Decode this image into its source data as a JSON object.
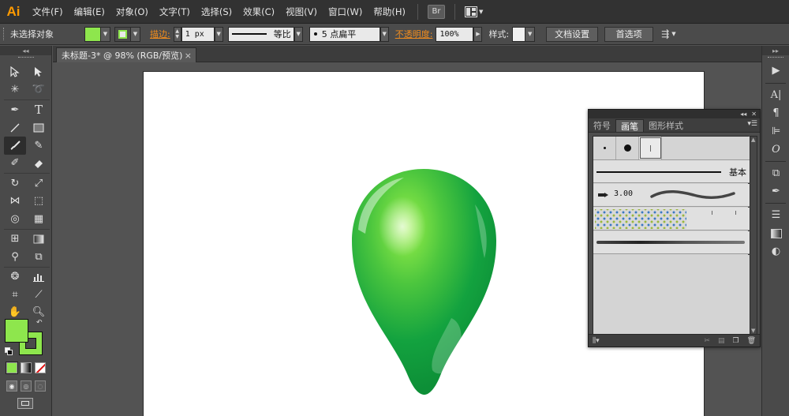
{
  "app": {
    "logo": "Ai"
  },
  "menu": {
    "items": [
      "文件(F)",
      "编辑(E)",
      "对象(O)",
      "文字(T)",
      "选择(S)",
      "效果(C)",
      "视图(V)",
      "窗口(W)",
      "帮助(H)"
    ],
    "bridge_icon": "Br"
  },
  "control_bar": {
    "selection_status": "未选择对象",
    "fill_color": "#8EE64D",
    "stroke_label": "描边:",
    "stroke_weight": "1 px",
    "stroke_profile": "等比",
    "brush_definition": "5 点扁平",
    "opacity_label": "不透明度:",
    "opacity_value": "100%",
    "style_label": "样式:",
    "document_setup_button": "文档设置",
    "preferences_button": "首选项"
  },
  "document": {
    "tab_title": "未标题-3* @ 98% (RGB/预览)",
    "close_symbol": "×"
  },
  "tools": {
    "fill_color": "#8EE64D",
    "stroke_color": "#8EE64D"
  },
  "artwork": {
    "shape": "green drop",
    "colors": {
      "light": "#9AF049",
      "mid": "#45C43C",
      "dark": "#0E9A3A"
    }
  },
  "brush_panel": {
    "tabs": [
      "符号",
      "画笔",
      "图形样式"
    ],
    "active_tab": "画笔",
    "basic_brush_label": "基本",
    "art_brush_size": "3.00"
  }
}
